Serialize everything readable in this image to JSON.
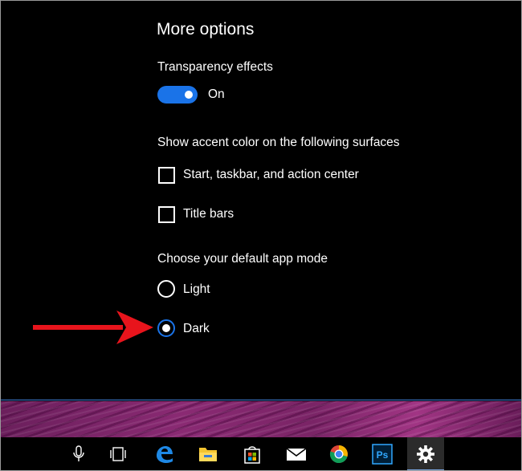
{
  "more_options": {
    "title": "More options",
    "transparency": {
      "label": "Transparency effects",
      "state": "On"
    },
    "accent": {
      "label": "Show accent color on the following surfaces",
      "options": [
        {
          "label": "Start, taskbar, and action center",
          "checked": false
        },
        {
          "label": "Title bars",
          "checked": false
        }
      ]
    },
    "app_mode": {
      "label": "Choose your default app mode",
      "options": [
        {
          "label": "Light",
          "selected": false
        },
        {
          "label": "Dark",
          "selected": true
        }
      ]
    }
  },
  "taskbar": {
    "items": [
      {
        "icon": "microphone-icon"
      },
      {
        "icon": "task-view-icon"
      },
      {
        "icon": "edge-icon"
      },
      {
        "icon": "file-explorer-icon"
      },
      {
        "icon": "store-icon"
      },
      {
        "icon": "mail-icon"
      },
      {
        "icon": "chrome-icon"
      },
      {
        "icon": "photoshop-icon",
        "text": "Ps"
      },
      {
        "icon": "settings-gear-icon",
        "active": true
      }
    ]
  },
  "colors": {
    "accent": "#1a73e8",
    "annotation_arrow": "#e8141c"
  }
}
